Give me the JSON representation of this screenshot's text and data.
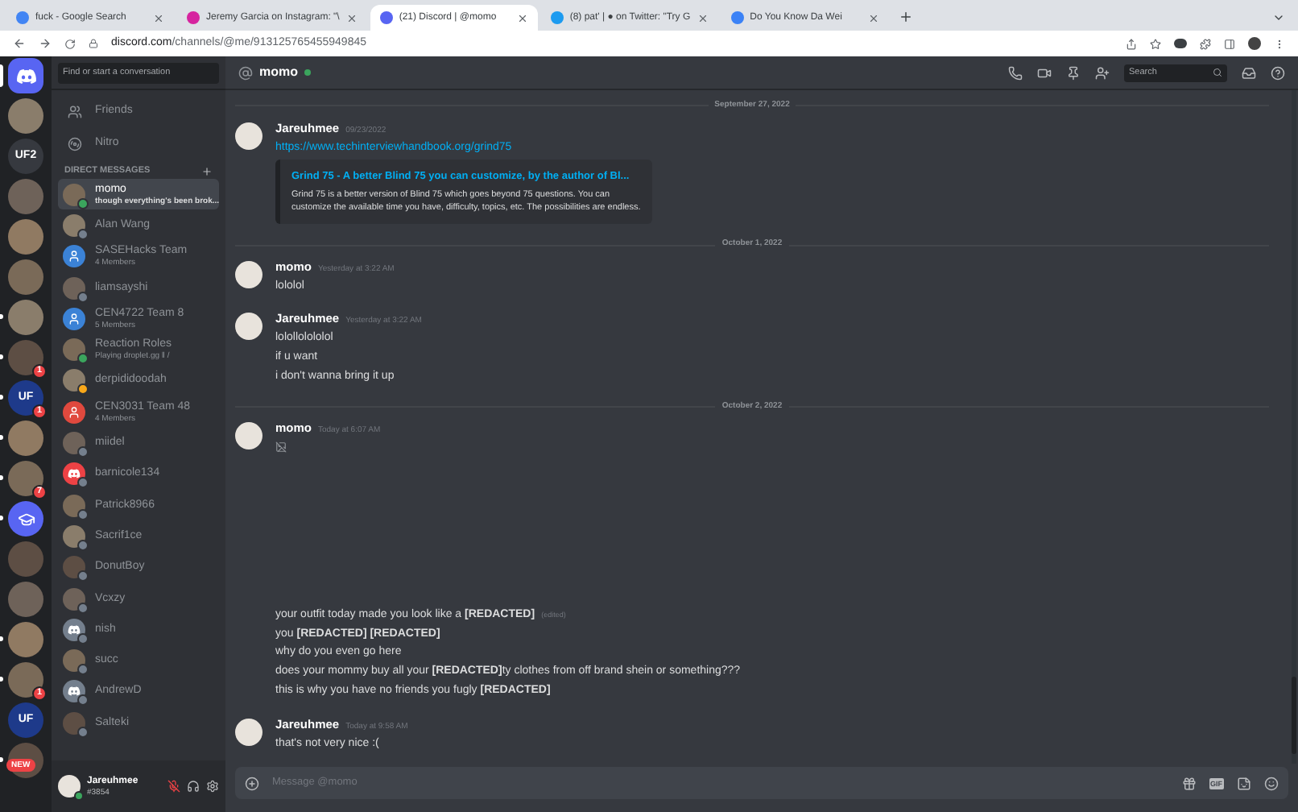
{
  "browser": {
    "tabs": [
      {
        "title": "fuck - Google Search",
        "kind": "google",
        "selected": false
      },
      {
        "title": "Jeremy Garcia on Instagram: \"\\",
        "kind": "instagram",
        "selected": false
      },
      {
        "title": "(21) Discord | @momo",
        "kind": "discord",
        "selected": true
      },
      {
        "title": "(8) pat' | ● on Twitter: \"Try G",
        "kind": "twitter",
        "selected": false
      },
      {
        "title": "Do You Know Da Wei",
        "kind": "globe",
        "selected": false
      }
    ],
    "address": {
      "host": "discord.com",
      "path": "/channels/@me/913125765455949845"
    }
  },
  "servers": [
    {
      "kind": "home",
      "selected": true
    },
    {
      "kind": "photo",
      "selected": false,
      "unread": false
    },
    {
      "kind": "text",
      "label": "UF2",
      "selected": false,
      "unread": false
    },
    {
      "kind": "photo",
      "selected": false,
      "unread": false
    },
    {
      "kind": "photo",
      "selected": false,
      "unread": false
    },
    {
      "kind": "photo",
      "selected": false,
      "unread": false
    },
    {
      "kind": "photo",
      "selected": false,
      "unread": true
    },
    {
      "kind": "photo",
      "selected": false,
      "unread": true,
      "badge": "1"
    },
    {
      "kind": "text",
      "label": "UF",
      "selected": false,
      "unread": true,
      "badge": "1"
    },
    {
      "kind": "photo",
      "selected": false,
      "unread": true
    },
    {
      "kind": "photo",
      "selected": false,
      "unread": true,
      "badge": "7"
    },
    {
      "kind": "icon",
      "selected": false,
      "unread": true
    },
    {
      "kind": "photo",
      "selected": false,
      "unread": false
    },
    {
      "kind": "photo",
      "selected": false,
      "unread": false
    },
    {
      "kind": "photo",
      "selected": false,
      "unread": true
    },
    {
      "kind": "photo",
      "selected": false,
      "unread": true,
      "badge": "1"
    },
    {
      "kind": "text",
      "label": "UF",
      "selected": false,
      "unread": false
    },
    {
      "kind": "photo",
      "selected": false,
      "unread": true,
      "tag": "NEW"
    }
  ],
  "sidebar": {
    "search_placeholder": "Find or start a conversation",
    "nav": [
      {
        "label": "Friends"
      },
      {
        "label": "Nitro"
      }
    ],
    "section_title": "DIRECT MESSAGES",
    "dms": [
      {
        "name": "momo",
        "subtitle": "though everything's been brok...",
        "kind": "photo",
        "status": {
          "color": "#3ba55d"
        },
        "selected": true
      },
      {
        "name": "Alan Wang",
        "kind": "photo",
        "status": {
          "color": "#747f8d"
        },
        "selected": false
      },
      {
        "name": "SASEHacks Team",
        "subtitle": "4 Members",
        "kind": "group",
        "color": "#3b82d6",
        "selected": false
      },
      {
        "name": "liamsayshi",
        "kind": "photo",
        "status": {
          "color": "#747f8d"
        },
        "selected": false
      },
      {
        "name": "CEN4722 Team 8",
        "subtitle": "5 Members",
        "kind": "group",
        "color": "#3b82d6",
        "selected": false
      },
      {
        "name": "Reaction Roles",
        "subtitle": "Playing droplet.gg ‖ /",
        "kind": "photo",
        "status": {
          "color": "#3ba55d"
        },
        "selected": false
      },
      {
        "name": "derpididoodah",
        "kind": "photo",
        "status": {
          "color": "#faa81a"
        },
        "selected": false
      },
      {
        "name": "CEN3031 Team 48",
        "subtitle": "4 Members",
        "kind": "group",
        "color": "#e0493e",
        "selected": false
      },
      {
        "name": "miidel",
        "kind": "photo",
        "status": {
          "color": "#747f8d"
        },
        "selected": false
      },
      {
        "name": "barnicole134",
        "kind": "default",
        "color": "#ed4245",
        "status": {
          "color": "#747f8d"
        },
        "selected": false
      },
      {
        "name": "Patrick8966",
        "kind": "photo",
        "status": {
          "color": "#747f8d"
        },
        "selected": false
      },
      {
        "name": "Sacrif1ce",
        "kind": "photo",
        "status": {
          "color": "#747f8d"
        },
        "selected": false
      },
      {
        "name": "DonutBoy",
        "kind": "photo",
        "status": {
          "color": "#747f8d"
        },
        "selected": false
      },
      {
        "name": "Vcxzy",
        "kind": "photo",
        "status": {
          "color": "#747f8d"
        },
        "selected": false
      },
      {
        "name": "nish",
        "kind": "default",
        "color": "#747f8d",
        "status": {
          "color": "#747f8d"
        },
        "selected": false
      },
      {
        "name": "succ",
        "kind": "photo",
        "status": {
          "color": "#747f8d"
        },
        "selected": false
      },
      {
        "name": "AndrewD",
        "kind": "default",
        "color": "#747f8d",
        "status": {
          "color": "#747f8d"
        },
        "selected": false
      },
      {
        "name": "Salteki",
        "kind": "photo",
        "status": {
          "color": "#747f8d"
        },
        "selected": false
      }
    ]
  },
  "user_panel": {
    "name": "Jareuhmee",
    "tag": "#3854",
    "mic_muted": true
  },
  "header": {
    "channel": "momo",
    "online": true,
    "search_placeholder": "Search"
  },
  "messages": [
    {
      "kind": "divider",
      "text": "September 27, 2022"
    },
    {
      "kind": "message",
      "author": "Jareuhmee",
      "time": "09/23/2022",
      "lines": [
        {
          "kind": "link",
          "text": "https://www.techinterviewhandbook.org/grind75"
        }
      ],
      "embed": {
        "title": "Grind 75 - A better Blind 75 you can customize, by the author of Bl...",
        "description": "Grind 75 is a better version of Blind 75 which goes beyond 75 questions. You can customize the available time you have, difficulty, topics, etc. The possibilities are endless."
      }
    },
    {
      "kind": "divider",
      "text": "October 1, 2022"
    },
    {
      "kind": "message",
      "author": "momo",
      "time": "Yesterday at 3:22 AM",
      "lines": [
        {
          "kind": "text",
          "text": "lololol"
        }
      ]
    },
    {
      "kind": "message",
      "author": "Jareuhmee",
      "time": "Yesterday at 3:22 AM",
      "lines": [
        {
          "kind": "text",
          "text": "lolollolololol"
        },
        {
          "kind": "text",
          "text": "if u want"
        },
        {
          "kind": "text",
          "text": "i don't wanna bring it up"
        }
      ]
    },
    {
      "kind": "divider",
      "text": "October 2, 2022"
    },
    {
      "kind": "message",
      "author": "momo",
      "time": "Today at 6:07 AM",
      "lines": [
        {
          "kind": "image"
        },
        {
          "kind": "text",
          "text": "your outfit today made you look like a **[REDACTED]**",
          "edited": "(edited)"
        },
        {
          "kind": "text",
          "text": "you **[REDACTED] [REDACTED]**"
        },
        {
          "kind": "text",
          "text": "why do you even go here"
        },
        {
          "kind": "text",
          "text": "does your mommy buy all your **[REDACTED]**ty clothes from off brand shein or something???"
        },
        {
          "kind": "text",
          "text": "this is why you have no friends you fugly **[REDACTED]**"
        }
      ]
    },
    {
      "kind": "message",
      "author": "Jareuhmee",
      "time": "Today at 9:58 AM",
      "lines": [
        {
          "kind": "text",
          "text": "that's not very nice :("
        }
      ]
    }
  ],
  "composer": {
    "placeholder": "Message @momo",
    "gif_label": "GIF"
  }
}
